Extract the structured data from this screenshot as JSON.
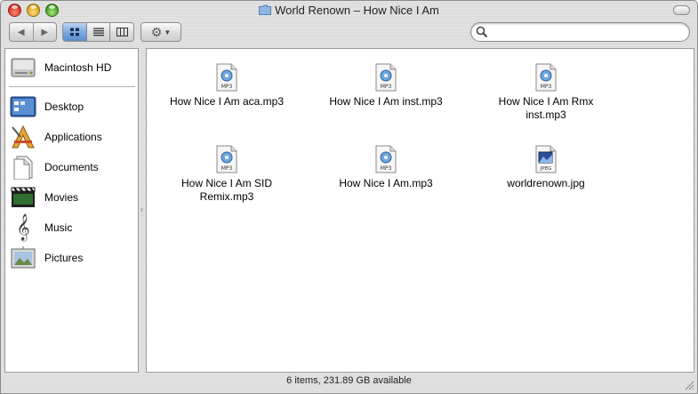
{
  "window": {
    "title": "World Renown – How Nice I Am"
  },
  "toolbar": {
    "back_icon": "back-arrow-icon",
    "forward_icon": "forward-arrow-icon",
    "views": [
      "icon-view",
      "list-view",
      "column-view"
    ],
    "active_view": "icon-view",
    "action_icon": "gear-icon",
    "search_placeholder": ""
  },
  "sidebar": {
    "items": [
      {
        "label": "Macintosh HD",
        "icon": "hard-drive-icon"
      },
      {
        "label": "Desktop",
        "icon": "desktop-icon"
      },
      {
        "label": "Applications",
        "icon": "applications-icon"
      },
      {
        "label": "Documents",
        "icon": "documents-icon"
      },
      {
        "label": "Movies",
        "icon": "movies-icon"
      },
      {
        "label": "Music",
        "icon": "music-icon"
      },
      {
        "label": "Pictures",
        "icon": "pictures-icon"
      }
    ]
  },
  "files": [
    {
      "name": "How Nice I Am aca.mp3",
      "type": "mp3",
      "badge": "MP3"
    },
    {
      "name": "How Nice I Am inst.mp3",
      "type": "mp3",
      "badge": "MP3"
    },
    {
      "name": "How Nice I Am Rmx inst.mp3",
      "type": "mp3",
      "badge": "MP3"
    },
    {
      "name": "How Nice I Am SID Remix.mp3",
      "type": "mp3",
      "badge": "MP3"
    },
    {
      "name": "How Nice I Am.mp3",
      "type": "mp3",
      "badge": "MP3"
    },
    {
      "name": "worldrenown.jpg",
      "type": "jpeg",
      "badge": "JPEG"
    }
  ],
  "status": {
    "text": "6 items, 231.89 GB available"
  },
  "colors": {
    "accent": "#5b8fd2",
    "close": "#d8291a",
    "minimize": "#d99a12",
    "zoom": "#3b9a1b"
  }
}
